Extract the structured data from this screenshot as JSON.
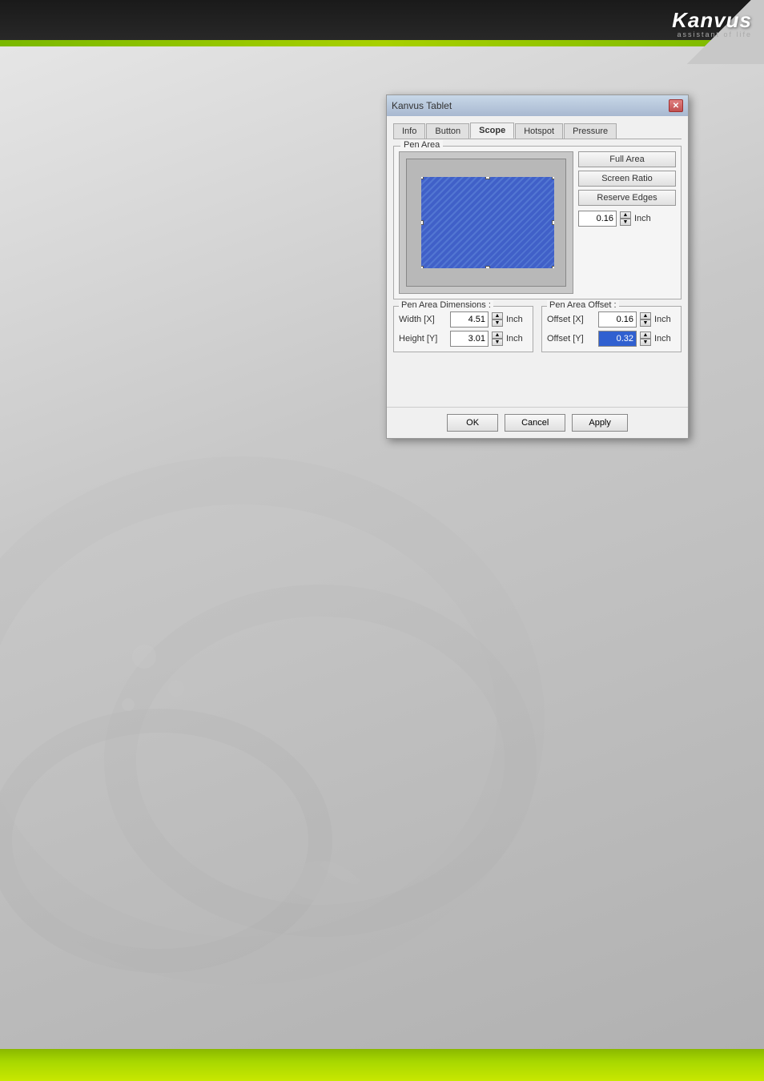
{
  "app": {
    "title": "Kanvus Tablet",
    "logo_text": "Kanvus",
    "logo_subtitle": "assistant of life"
  },
  "dialog": {
    "title": "Kanvus Tablet",
    "close_label": "✕",
    "tabs": [
      {
        "id": "info",
        "label": "Info",
        "active": false
      },
      {
        "id": "button",
        "label": "Button",
        "active": false
      },
      {
        "id": "scope",
        "label": "Scope",
        "active": true
      },
      {
        "id": "hotspot",
        "label": "Hotspot",
        "active": false
      },
      {
        "id": "pressure",
        "label": "Pressure",
        "active": false
      }
    ],
    "pen_area_group_label": "Pen Area",
    "buttons": {
      "full_area": "Full Area",
      "screen_ratio": "Screen Ratio",
      "reserve_edges": "Reserve Edges",
      "reserve_value": "0.16",
      "reserve_unit": "Inch"
    },
    "dimensions": {
      "group_label": "Pen Area Dimensions :",
      "width_label": "Width [X]",
      "width_value": "4.51",
      "width_unit": "Inch",
      "height_label": "Height [Y]",
      "height_value": "3.01",
      "height_unit": "Inch"
    },
    "offset": {
      "group_label": "Pen Area Offset :",
      "offset_x_label": "Offset [X]",
      "offset_x_value": "0.16",
      "offset_x_unit": "Inch",
      "offset_y_label": "Offset [Y]",
      "offset_y_value": "0.32",
      "offset_y_unit": "Inch"
    },
    "footer": {
      "ok_label": "OK",
      "cancel_label": "Cancel",
      "apply_label": "Apply"
    }
  }
}
